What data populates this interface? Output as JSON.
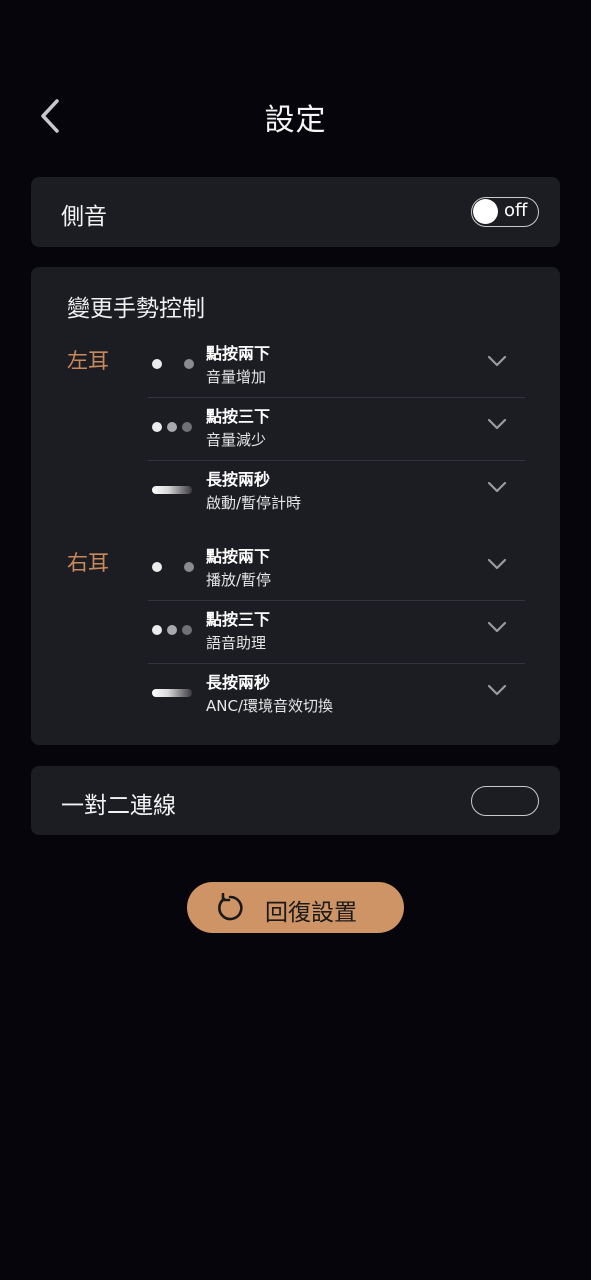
{
  "header": {
    "title": "設定",
    "back_icon": "chevron-left-icon"
  },
  "sidetone": {
    "label": "側音",
    "toggle_state": "off"
  },
  "gesture": {
    "title": "變更手勢控制",
    "left": {
      "label": "左耳",
      "items": [
        {
          "gesture": "點按兩下",
          "action": "音量增加",
          "icon": "double-tap-icon"
        },
        {
          "gesture": "點按三下",
          "action": "音量減少",
          "icon": "triple-tap-icon"
        },
        {
          "gesture": "長按兩秒",
          "action": "啟動/暫停計時",
          "icon": "long-press-icon"
        }
      ]
    },
    "right": {
      "label": "右耳",
      "items": [
        {
          "gesture": "點按兩下",
          "action": "播放/暫停",
          "icon": "double-tap-icon"
        },
        {
          "gesture": "點按三下",
          "action": "語音助理",
          "icon": "triple-tap-icon"
        },
        {
          "gesture": "長按兩秒",
          "action": "ANC/環境音效切換",
          "icon": "long-press-icon"
        }
      ]
    }
  },
  "multipoint": {
    "label": "一對二連線"
  },
  "reset_button": {
    "label": "回復設置",
    "icon": "reset-icon"
  },
  "colors": {
    "background": "#05050b",
    "card": "#1c1d23",
    "accent": "#c8895c",
    "button": "#cf9466"
  }
}
